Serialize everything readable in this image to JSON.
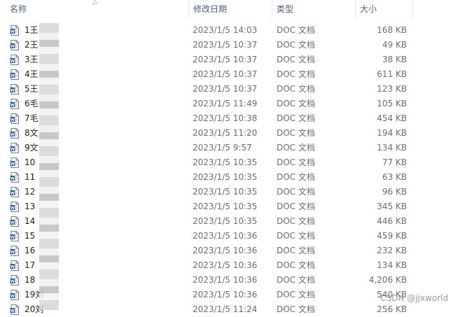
{
  "header": {
    "name": "名称",
    "date": "修改日期",
    "type": "类型",
    "size": "大小"
  },
  "files": [
    {
      "name": "1王",
      "date": "2023/1/5 14:03",
      "type": "DOC 文档",
      "size": "168 KB"
    },
    {
      "name": "2王",
      "date": "2023/1/5 10:37",
      "type": "DOC 文档",
      "size": "49 KB"
    },
    {
      "name": "3王",
      "date": "2023/1/5 10:37",
      "type": "DOC 文档",
      "size": "38 KB"
    },
    {
      "name": "4王",
      "date": "2023/1/5 10:37",
      "type": "DOC 文档",
      "size": "611 KB"
    },
    {
      "name": "5王",
      "date": "2023/1/5 10:37",
      "type": "DOC 文档",
      "size": "123 KB"
    },
    {
      "name": "6毛",
      "date": "2023/1/5 11:49",
      "type": "DOC 文档",
      "size": "105 KB"
    },
    {
      "name": "7毛",
      "date": "2023/1/5 10:38",
      "type": "DOC 文档",
      "size": "454 KB"
    },
    {
      "name": "8文",
      "date": "2023/1/5 11:20",
      "type": "DOC 文档",
      "size": "194 KB"
    },
    {
      "name": "9文",
      "date": "2023/1/5 9:57",
      "type": "DOC 文档",
      "size": "134 KB"
    },
    {
      "name": "10",
      "date": "2023/1/5 10:35",
      "type": "DOC 文档",
      "size": "77 KB"
    },
    {
      "name": "11",
      "date": "2023/1/5 10:35",
      "type": "DOC 文档",
      "size": "63 KB"
    },
    {
      "name": "12",
      "date": "2023/1/5 10:35",
      "type": "DOC 文档",
      "size": "96 KB"
    },
    {
      "name": "13",
      "date": "2023/1/5 10:35",
      "type": "DOC 文档",
      "size": "345 KB"
    },
    {
      "name": "14",
      "date": "2023/1/5 10:35",
      "type": "DOC 文档",
      "size": "446 KB"
    },
    {
      "name": "15",
      "date": "2023/1/5 10:36",
      "type": "DOC 文档",
      "size": "459 KB"
    },
    {
      "name": "16",
      "date": "2023/1/5 10:36",
      "type": "DOC 文档",
      "size": "232 KB"
    },
    {
      "name": "17",
      "date": "2023/1/5 10:36",
      "type": "DOC 文档",
      "size": "134 KB"
    },
    {
      "name": "18",
      "date": "2023/1/5 10:36",
      "type": "DOC 文档",
      "size": "4,206 KB"
    },
    {
      "name": "19刘",
      "date": "2023/1/5 10:36",
      "type": "DOC 文档",
      "size": "540 KB"
    },
    {
      "name": "20刘",
      "date": "2023/1/5 11:24",
      "type": "DOC 文档",
      "size": "256 KB"
    }
  ],
  "watermark": "CSDN @jjxworld",
  "colors": {
    "header_text": "#4c607a",
    "detail_text": "#6d6d6d",
    "icon_blue": "#2b579a"
  },
  "icons": {
    "file": "word-doc-icon",
    "sort": "sort-ascending-icon"
  }
}
